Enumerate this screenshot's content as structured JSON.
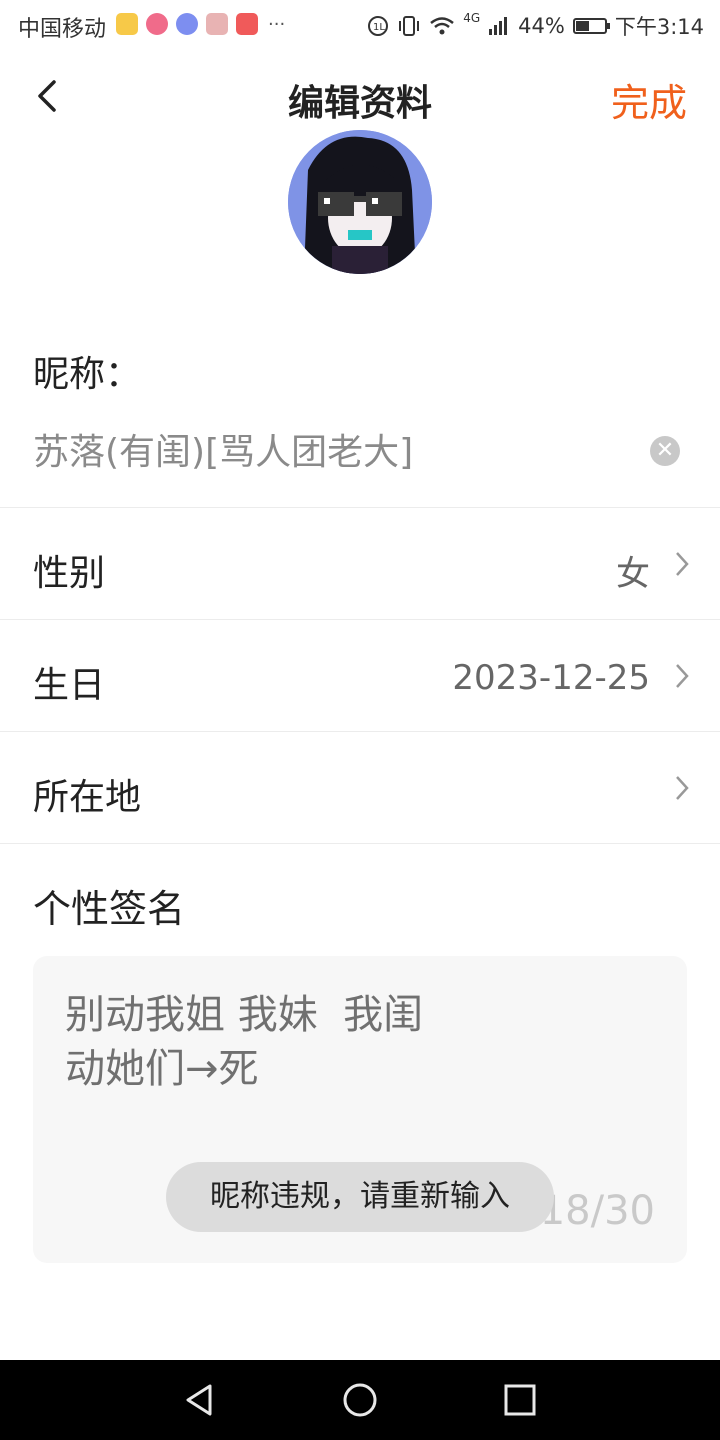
{
  "status_bar": {
    "carrier": "中国移动",
    "network": "4G",
    "battery": "44%",
    "battery_level": 0.44,
    "time": "下午3:14",
    "more": "···"
  },
  "nav": {
    "title": "编辑资料",
    "done_label": "完成"
  },
  "nickname": {
    "label": "昵称：",
    "value": "苏落(有闺)[骂人团老大]"
  },
  "rows": [
    {
      "label": "性别",
      "value": "女"
    },
    {
      "label": "生日",
      "value": "2023-12-25"
    },
    {
      "label": "所在地",
      "value": ""
    }
  ],
  "signature": {
    "label": "个性签名",
    "text": "别动我姐 我妹  我闺\n动她们→死",
    "count": "18/30"
  },
  "toast": {
    "message": "昵称违规，请重新输入"
  },
  "colors": {
    "accent": "#f0601c",
    "avatar_bg": "#7f93e6"
  },
  "icons": [
    "back-arrow-icon",
    "clear-icon",
    "chevron-right-icon",
    "nav-back-icon",
    "nav-home-icon",
    "nav-recents-icon"
  ]
}
